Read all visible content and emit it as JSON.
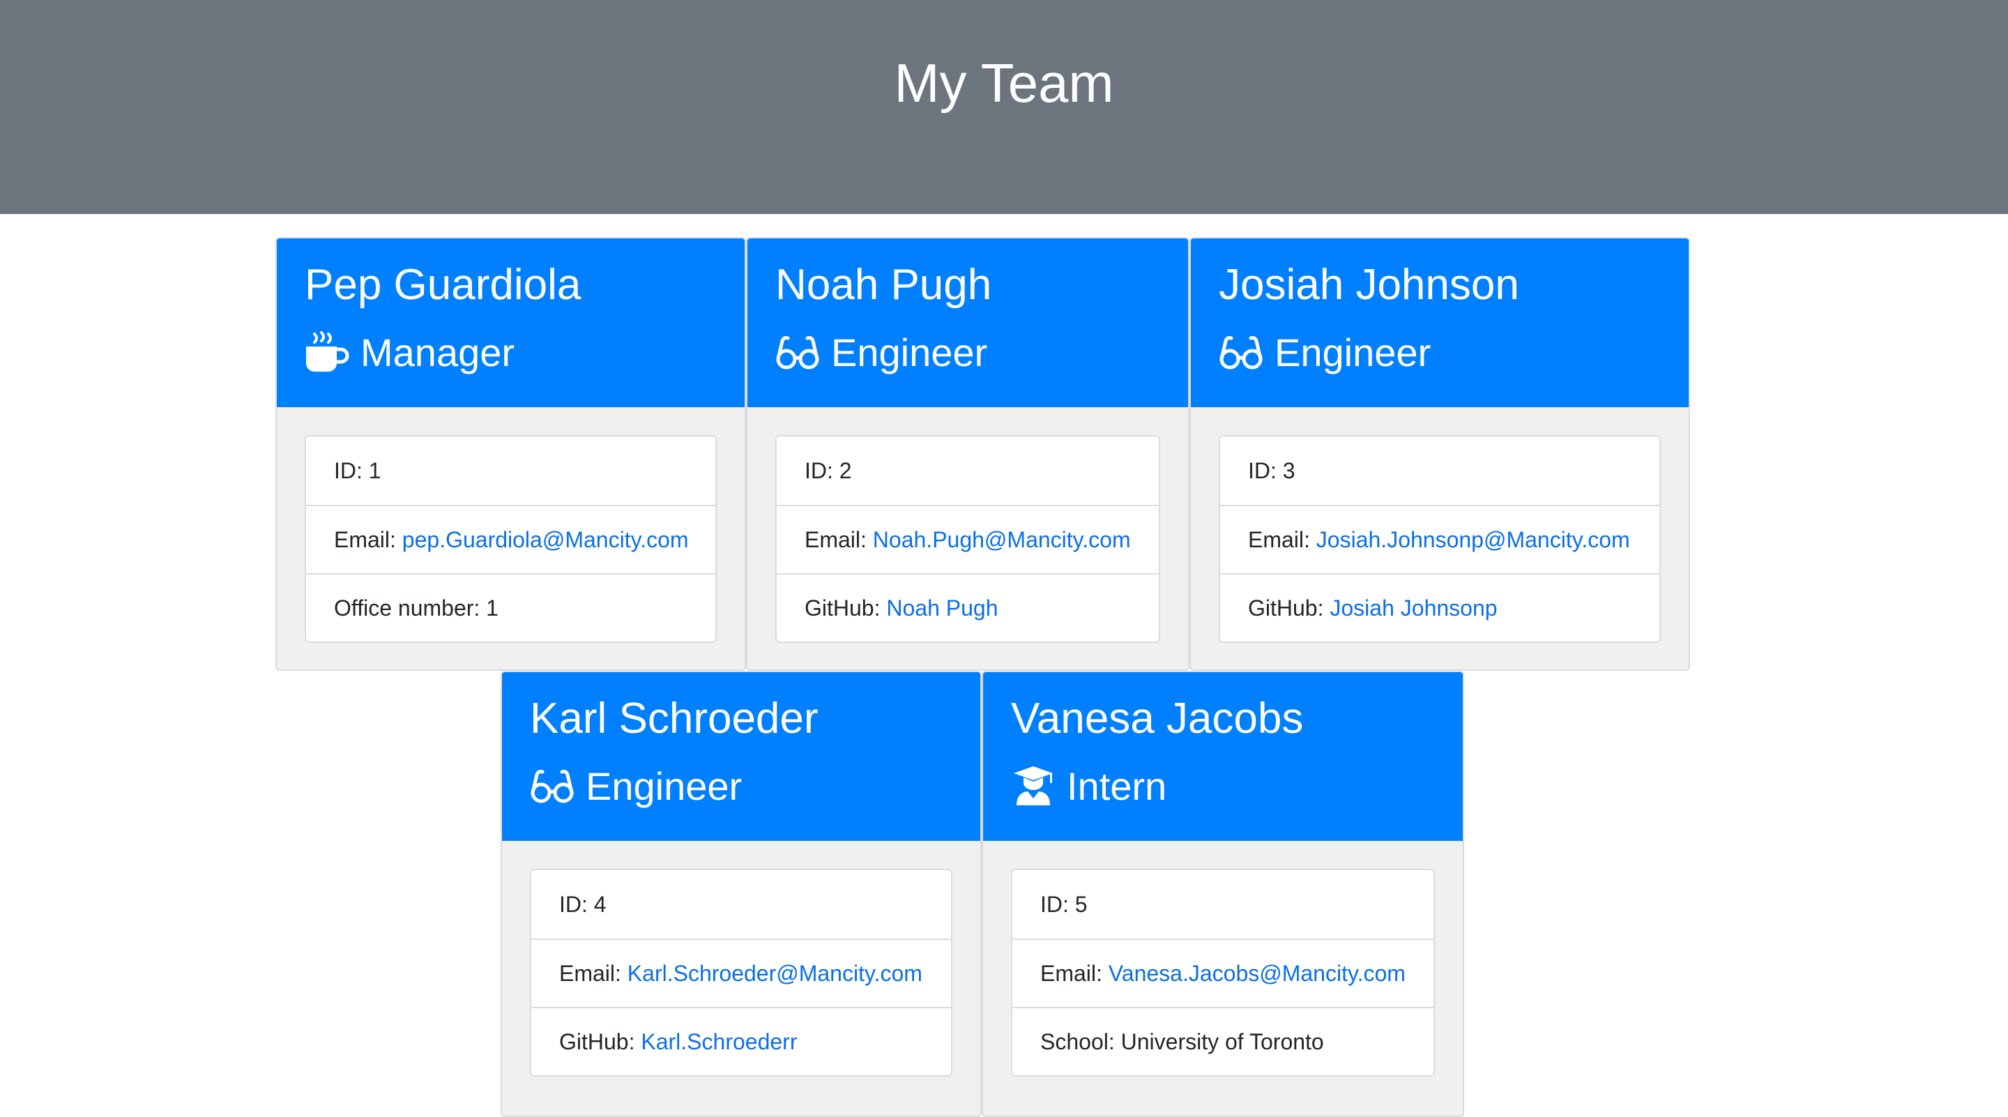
{
  "header": {
    "title": "My Team"
  },
  "colors": {
    "header_bg": "#6c757d",
    "card_head_bg": "#0080ff",
    "link": "#0a6fe8"
  },
  "cards": [
    {
      "name": "Pep Guardiola",
      "role": "Manager",
      "icon": "coffee-icon",
      "id_text": "ID: 1",
      "email_label": "Email: ",
      "email": "pep.Guardiola@Mancity.com",
      "extra_label": "Office number: 1",
      "extra_value": ""
    },
    {
      "name": "Noah Pugh",
      "role": "Engineer",
      "icon": "glasses-icon",
      "id_text": "ID: 2",
      "email_label": "Email: ",
      "email": "Noah.Pugh@Mancity.com",
      "extra_label": "GitHub: ",
      "extra_value": "Noah Pugh"
    },
    {
      "name": "Josiah Johnson",
      "role": "Engineer",
      "icon": "glasses-icon",
      "id_text": "ID: 3",
      "email_label": "Email: ",
      "email": "Josiah.Johnsonp@Mancity.com",
      "extra_label": "GitHub: ",
      "extra_value": "Josiah Johnsonp"
    },
    {
      "name": "Karl Schroeder",
      "role": "Engineer",
      "icon": "glasses-icon",
      "id_text": "ID: 4",
      "email_label": "Email: ",
      "email": "Karl.Schroeder@Mancity.com",
      "extra_label": "GitHub: ",
      "extra_value": "Karl.Schroederr"
    },
    {
      "name": "Vanesa Jacobs",
      "role": "Intern",
      "icon": "graduate-icon",
      "id_text": "ID: 5",
      "email_label": "Email: ",
      "email": "Vanesa.Jacobs@Mancity.com",
      "extra_label": "School: University of Toronto",
      "extra_value": ""
    }
  ]
}
